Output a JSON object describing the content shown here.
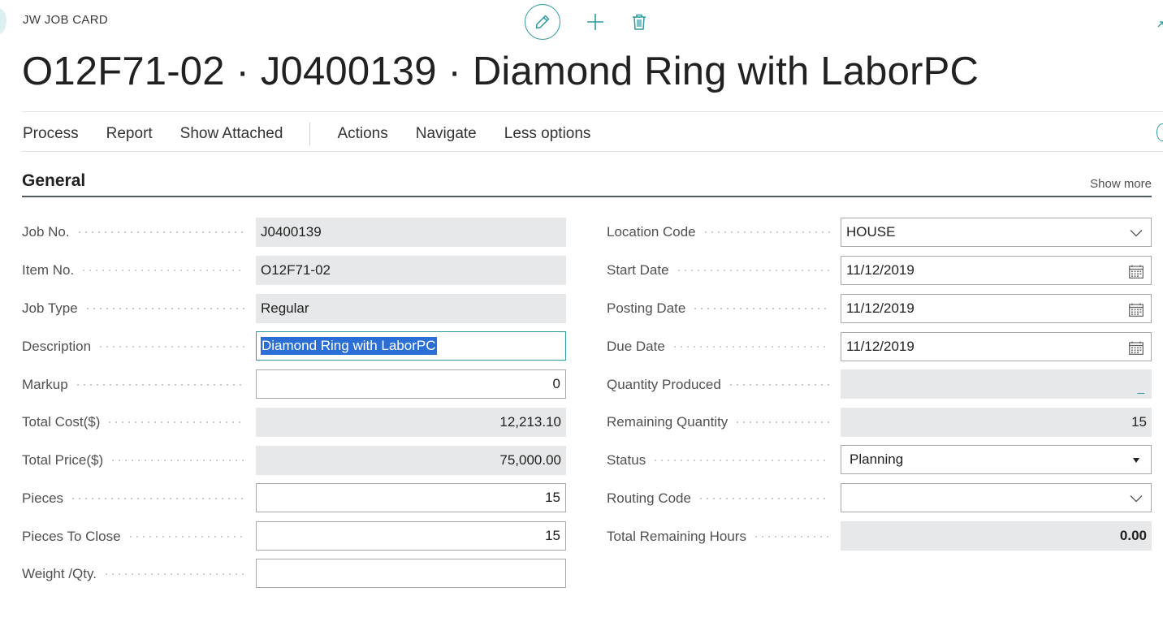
{
  "header": {
    "page_kind": "JW JOB CARD",
    "title": "O12F71-02 · J0400139 · Diamond Ring with LaborPC",
    "icons": {
      "edit": "pencil-icon",
      "new": "plus-icon",
      "delete": "trash-icon"
    }
  },
  "menu": {
    "items": [
      "Process",
      "Report",
      "Show Attached",
      "Actions",
      "Navigate",
      "Less options"
    ]
  },
  "section": {
    "title": "General",
    "show_more": "Show more"
  },
  "left_fields": [
    {
      "label": "Job No.",
      "value": "J0400139"
    },
    {
      "label": "Item No.",
      "value": "O12F71-02"
    },
    {
      "label": "Job Type",
      "value": "Regular"
    },
    {
      "label": "Description",
      "value": "Diamond Ring with LaborPC"
    },
    {
      "label": "Markup",
      "value": "0"
    },
    {
      "label": "Total Cost($)",
      "value": "12,213.10"
    },
    {
      "label": "Total Price($)",
      "value": "75,000.00"
    },
    {
      "label": "Pieces",
      "value": "15"
    },
    {
      "label": "Pieces To Close",
      "value": "15"
    },
    {
      "label": "Weight /Qty.",
      "value": ""
    }
  ],
  "right_fields": [
    {
      "label": "Location Code",
      "value": "HOUSE"
    },
    {
      "label": "Start Date",
      "value": "11/12/2019"
    },
    {
      "label": "Posting Date",
      "value": "11/12/2019"
    },
    {
      "label": "Due Date",
      "value": "11/12/2019"
    },
    {
      "label": "Quantity Produced",
      "value": "_"
    },
    {
      "label": "Remaining Quantity",
      "value": "15"
    },
    {
      "label": "Status",
      "value": "Planning"
    },
    {
      "label": "Routing Code",
      "value": ""
    },
    {
      "label": "Total Remaining Hours",
      "value": "0.00"
    }
  ],
  "colors": {
    "accent": "#2c9a9f",
    "readonly_bg": "#e7e8e9",
    "selection": "#2b6fd6"
  }
}
